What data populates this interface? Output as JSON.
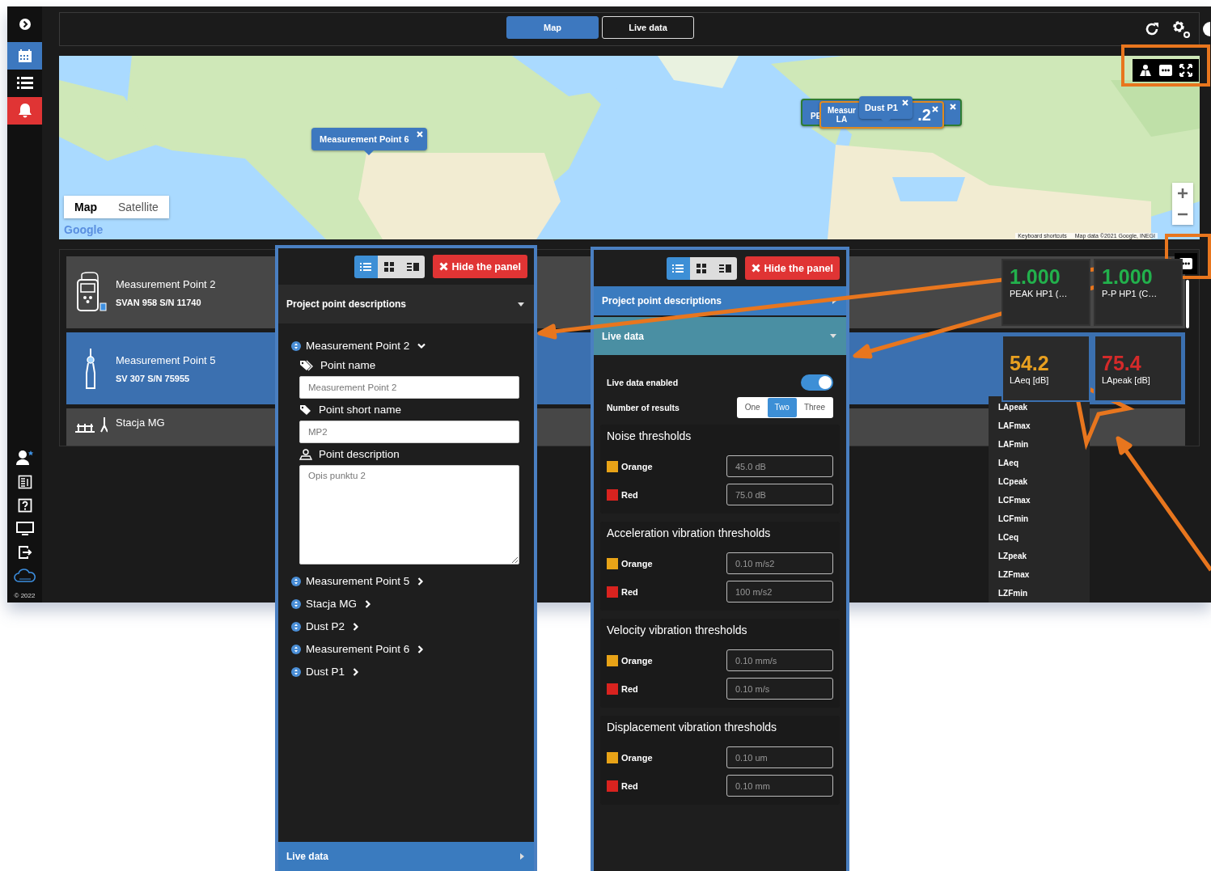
{
  "sidebar": {
    "items": [
      {
        "kind": "expand",
        "selected": false,
        "alert": false
      },
      {
        "kind": "calendar",
        "selected": true,
        "alert": false
      },
      {
        "kind": "list",
        "selected": false,
        "alert": false
      },
      {
        "kind": "bell",
        "selected": false,
        "alert": true
      }
    ],
    "bottom_items": [
      {
        "kind": "user"
      },
      {
        "kind": "report"
      },
      {
        "kind": "help"
      },
      {
        "kind": "monitor"
      },
      {
        "kind": "logout"
      },
      {
        "kind": "cloud"
      }
    ],
    "copyright": "© 2022"
  },
  "view_tabs": [
    {
      "label": "Map",
      "selected": true
    },
    {
      "label": "Live data",
      "selected": false
    }
  ],
  "map": {
    "map_types": [
      {
        "label": "Map",
        "selected": true
      },
      {
        "label": "Satellite",
        "selected": false
      }
    ],
    "logo": "Google",
    "attribution": [
      "Keyboard shortcuts",
      "Map data ©2021 Google, INEGI"
    ],
    "popups": [
      {
        "kind": "single",
        "label": "Measurement Point 6"
      },
      {
        "kind": "cluster",
        "color": "#2e7d32",
        "label": "PE"
      },
      {
        "kind": "cluster",
        "color": "#e08a1e",
        "label": "Measur",
        "sublabel": "LA",
        "value": ".2"
      },
      {
        "kind": "single",
        "label": "Dust P1"
      }
    ]
  },
  "points": [
    {
      "kind": "meter",
      "name": "Measurement Point 2",
      "device": "SVAN 958 S/N 11740",
      "selected": false,
      "tiles": [
        {
          "value": "1.000",
          "label": "PEAK HP1 (…",
          "color": "#22b14c"
        },
        {
          "value": "1.000",
          "label": "P-P HP1 (C…",
          "color": "#22b14c"
        }
      ]
    },
    {
      "kind": "probe",
      "name": "Measurement Point 5",
      "device": "SV 307 S/N 75955",
      "selected": true,
      "tiles": [
        {
          "value": "54.2",
          "label": "LAeq [dB]",
          "color": "#e8a020"
        },
        {
          "value": "75.4",
          "label": "LApeak [dB]",
          "color": "#d42a2a"
        }
      ]
    },
    {
      "kind": "station",
      "name": "Stacja MG",
      "selected": false
    }
  ],
  "measure_menu": [
    "LApeak",
    "LAFmax",
    "LAFmin",
    "LAeq",
    "LCpeak",
    "LCFmax",
    "LCFmin",
    "LCeq",
    "LZpeak",
    "LZFmax",
    "LZFmin"
  ],
  "panels": [
    {
      "views": [
        {
          "kind": "list",
          "selected": true
        },
        {
          "kind": "grid",
          "selected": false
        },
        {
          "kind": "detail",
          "selected": false
        }
      ],
      "hide_button": "Hide the panel",
      "sections": [
        {
          "kind": "points",
          "title": "Project point descriptions",
          "expanded": true,
          "tree": [
            {
              "name": "Measurement Point 2",
              "expanded": true,
              "fields": [
                {
                  "kind": "input",
                  "label": "Point name",
                  "value": "Measurement Point 2"
                },
                {
                  "kind": "input",
                  "label": "Point short name",
                  "value": "MP2"
                },
                {
                  "kind": "textarea",
                  "label": "Point description",
                  "value": "Opis punktu 2"
                }
              ]
            },
            {
              "name": "Measurement Point 5",
              "expanded": false
            },
            {
              "name": "Stacja MG",
              "expanded": false
            },
            {
              "name": "Dust P2",
              "expanded": false
            },
            {
              "name": "Measurement Point 6",
              "expanded": false
            },
            {
              "name": "Dust P1",
              "expanded": false
            }
          ]
        },
        {
          "kind": "live",
          "title": "Live data",
          "expanded": false
        }
      ]
    },
    {
      "views": [
        {
          "kind": "list",
          "selected": true
        },
        {
          "kind": "grid",
          "selected": false
        },
        {
          "kind": "detail",
          "selected": false
        }
      ],
      "hide_button": "Hide the panel",
      "sections": [
        {
          "kind": "points",
          "title": "Project point descriptions",
          "expanded": false
        },
        {
          "kind": "live",
          "title": "Live data",
          "expanded": true,
          "enabled": {
            "label": "Live data enabled",
            "on": true
          },
          "results": {
            "label": "Number of results",
            "options": [
              {
                "label": "One",
                "selected": false
              },
              {
                "label": "Two",
                "selected": true
              },
              {
                "label": "Three",
                "selected": false
              }
            ]
          },
          "groups": [
            {
              "title": "Noise thresholds",
              "rows": [
                {
                  "label": "Orange",
                  "color": "#e8a317",
                  "value": "45.0 dB"
                },
                {
                  "label": "Red",
                  "color": "#d9231f",
                  "value": "75.0 dB"
                }
              ]
            },
            {
              "title": "Acceleration vibration thresholds",
              "rows": [
                {
                  "label": "Orange",
                  "color": "#e8a317",
                  "value": "0.10 m/s2"
                },
                {
                  "label": "Red",
                  "color": "#d9231f",
                  "value": "100 m/s2"
                }
              ]
            },
            {
              "title": "Velocity vibration thresholds",
              "rows": [
                {
                  "label": "Orange",
                  "color": "#e8a317",
                  "value": "0.10 mm/s"
                },
                {
                  "label": "Red",
                  "color": "#d9231f",
                  "value": "0.10 m/s"
                }
              ]
            },
            {
              "title": "Displacement vibration thresholds",
              "rows": [
                {
                  "label": "Orange",
                  "color": "#e8a317",
                  "value": "0.10 um"
                },
                {
                  "label": "Red",
                  "color": "#d9231f",
                  "value": "0.10 mm"
                }
              ]
            }
          ]
        }
      ]
    }
  ]
}
